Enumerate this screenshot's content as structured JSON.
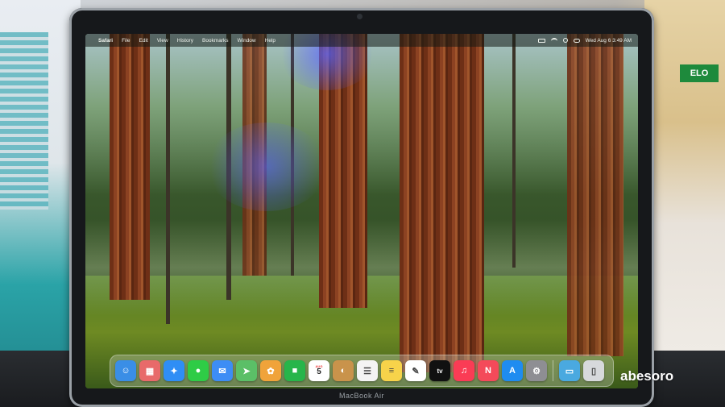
{
  "menubar": {
    "apple_icon": "apple-icon",
    "app_name": "Safari",
    "items": [
      "File",
      "Edit",
      "View",
      "History",
      "Bookmarks",
      "Window",
      "Help"
    ],
    "status_icons": [
      "battery-icon",
      "wifi-icon",
      "search-icon",
      "control-center-icon"
    ],
    "clock": "Wed Aug 6  3:49 AM"
  },
  "dock": {
    "apps": [
      {
        "icon": "finder-icon",
        "glyph": "☺",
        "color": "#3a8ee6"
      },
      {
        "icon": "launchpad-icon",
        "glyph": "▦",
        "color": "#e86a6a"
      },
      {
        "icon": "safari-icon",
        "glyph": "✦",
        "color": "#2f8ef5"
      },
      {
        "icon": "messages-icon",
        "glyph": "●",
        "color": "#2ecc46"
      },
      {
        "icon": "mail-icon",
        "glyph": "✉",
        "color": "#3d8df5"
      },
      {
        "icon": "maps-icon",
        "glyph": "➤",
        "color": "#5bbf67"
      },
      {
        "icon": "photos-icon",
        "glyph": "✿",
        "color": "#f0a33a"
      },
      {
        "icon": "facetime-icon",
        "glyph": "■",
        "color": "#27b54a"
      },
      {
        "icon": "calendar-icon",
        "glyph": "5",
        "color": "#ffffff"
      },
      {
        "icon": "contacts-icon",
        "glyph": "◐",
        "color": "#c9934b"
      },
      {
        "icon": "reminders-icon",
        "glyph": "☰",
        "color": "#f4f4f4"
      },
      {
        "icon": "notes-icon",
        "glyph": "≡",
        "color": "#f7d34a"
      },
      {
        "icon": "freeform-icon",
        "glyph": "✎",
        "color": "#ffffff"
      },
      {
        "icon": "apple-tv-icon",
        "glyph": "tv",
        "color": "#111111"
      },
      {
        "icon": "music-icon",
        "glyph": "♫",
        "color": "#fa3c55"
      },
      {
        "icon": "news-icon",
        "glyph": "N",
        "color": "#f44a5a"
      },
      {
        "icon": "app-store-icon",
        "glyph": "A",
        "color": "#1f8cf0"
      },
      {
        "icon": "system-settings-icon",
        "glyph": "⚙",
        "color": "#8e8e93"
      }
    ],
    "trailing": [
      {
        "icon": "downloads-folder-icon",
        "glyph": "▭",
        "color": "#4aa9e0"
      },
      {
        "icon": "trash-icon",
        "glyph": "▯",
        "color": "#d7d9dc"
      }
    ],
    "calendar_month": "AUG",
    "calendar_day": "5"
  },
  "laptop": {
    "model_label": "MacBook Air"
  },
  "background_sign": "ELO",
  "watermark": "abesoro"
}
